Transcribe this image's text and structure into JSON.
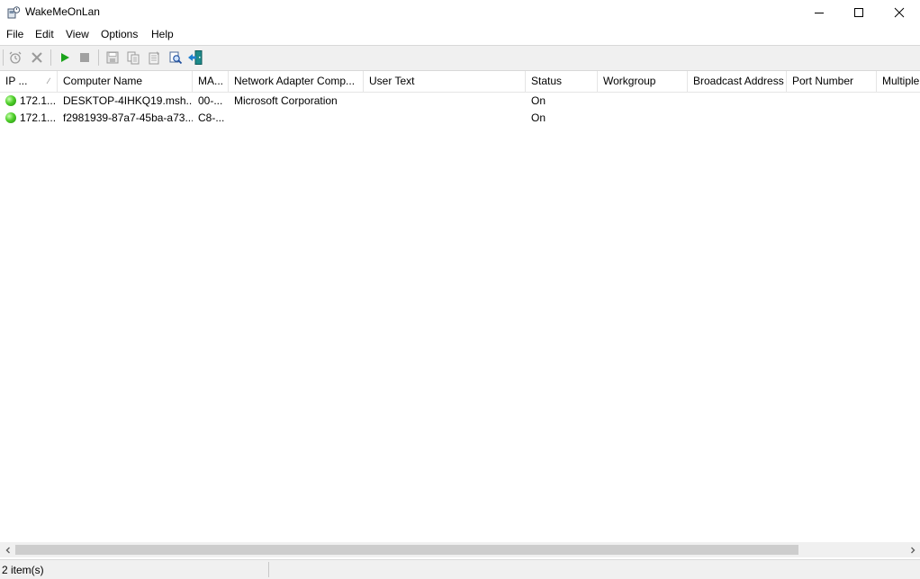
{
  "window": {
    "title": "WakeMeOnLan"
  },
  "menu": {
    "items": [
      "File",
      "Edit",
      "View",
      "Options",
      "Help"
    ]
  },
  "table": {
    "columns": [
      "IP ...",
      "Computer Name",
      "MA...",
      "Network Adapter Comp...",
      "User Text",
      "Status",
      "Workgroup",
      "Broadcast Address",
      "Port Number",
      "Multiple"
    ],
    "sort_indicator": "∕",
    "rows": [
      {
        "ip": "172.1...",
        "computer_name": "DESKTOP-4IHKQ19.msh...",
        "mac": "00-...",
        "adapter_company": "Microsoft Corporation",
        "user_text": "",
        "status": "On",
        "workgroup": "",
        "broadcast": "",
        "port": "",
        "multiple": ""
      },
      {
        "ip": "172.1...",
        "computer_name": "f2981939-87a7-45ba-a73...",
        "mac": "C8-...",
        "adapter_company": "",
        "user_text": "",
        "status": "On",
        "workgroup": "",
        "broadcast": "",
        "port": "",
        "multiple": ""
      }
    ]
  },
  "statusbar": {
    "text": "2 item(s)"
  },
  "colors": {
    "status_on": "#3fbf1f",
    "toolbar_bg": "#f0f0f0",
    "scroll_thumb": "#cdcdcd"
  }
}
